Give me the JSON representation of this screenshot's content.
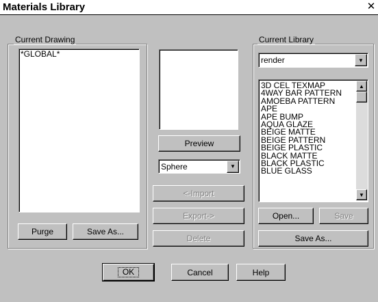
{
  "window": {
    "title": "Materials Library",
    "close_glyph": "✕"
  },
  "current_drawing": {
    "legend": "Current Drawing",
    "items": [
      "*GLOBAL*"
    ],
    "purge_label": "Purge",
    "save_as_label": "Save As..."
  },
  "preview": {
    "preview_label": "Preview",
    "shape_value": "Sphere",
    "import_label": "<-Import",
    "export_label": "Export->",
    "delete_label": "Delete"
  },
  "current_library": {
    "legend": "Current Library",
    "library_value": "render",
    "items": [
      "3D CEL TEXMAP",
      "4WAY BAR PATTERN",
      "AMOEBA PATTERN",
      "APE",
      "APE BUMP",
      "AQUA GLAZE",
      "BEIGE MATTE",
      "BEIGE PATTERN",
      "BEIGE PLASTIC",
      "BLACK MATTE",
      "BLACK PLASTIC",
      "BLUE GLASS"
    ],
    "open_label": "Open...",
    "save_label": "Save",
    "save_as_label": "Save As..."
  },
  "footer": {
    "ok_label": "OK",
    "cancel_label": "Cancel",
    "help_label": "Help"
  }
}
